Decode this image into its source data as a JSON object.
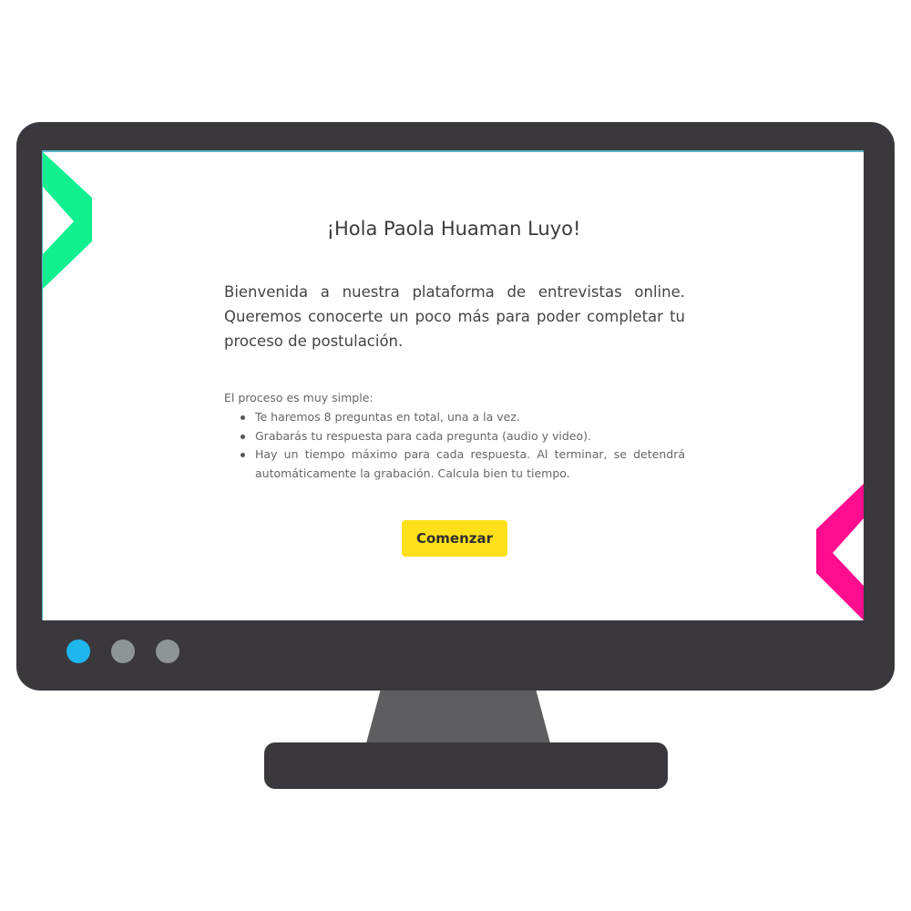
{
  "greeting": "¡Hola Paola Huaman Luyo!",
  "intro": "Bienvenida a nuestra plataforma de entrevistas online. Queremos conocerte un poco más para poder completar tu proceso de postulación.",
  "process": {
    "title": "El proceso es muy simple:",
    "steps": [
      "Te haremos 8 preguntas en total, una a la vez.",
      "Grabarás tu respuesta para cada pregunta (audio y video).",
      "Hay un tiempo máximo para cada respuesta. Al terminar, se detendrá automáticamente la grabación. Calcula bien tu tiempo."
    ]
  },
  "start_button": "Comenzar",
  "colors": {
    "monitor": "#3a383d",
    "stand": "#5e5e60",
    "accent_green": "#10f08f",
    "accent_pink": "#ff0c8f",
    "button": "#ffe01a",
    "dot_active": "#1fb6ee",
    "dot_inactive": "#8f9596"
  },
  "icons": {
    "top_left": "chevron-right-icon",
    "bottom_right": "chevron-left-icon"
  }
}
